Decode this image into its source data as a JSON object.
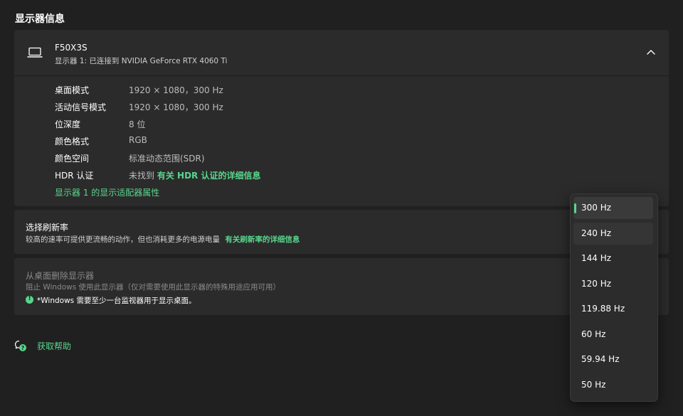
{
  "section_title": "显示器信息",
  "monitor": {
    "name": "F50X3S",
    "subtitle": "显示器 1: 已连接到 NVIDIA GeForce RTX 4060 Ti",
    "details": [
      {
        "label": "桌面模式",
        "value": "1920 × 1080，300 Hz"
      },
      {
        "label": "活动信号模式",
        "value": "1920 × 1080，300 Hz"
      },
      {
        "label": "位深度",
        "value": "8 位"
      },
      {
        "label": "颜色格式",
        "value": "RGB"
      },
      {
        "label": "颜色空间",
        "value": "标准动态范围(SDR)"
      },
      {
        "label": "HDR 认证",
        "value": "未找到",
        "link": "有关 HDR 认证的详细信息"
      }
    ],
    "adapter_link": "显示器 1 的显示适配器属性"
  },
  "refresh": {
    "title": "选择刷新率",
    "description": "较高的速率可提供更流畅的动作，但也消耗更多的电源电量",
    "link": "有关刷新率的详细信息"
  },
  "remove": {
    "title": "从桌面删除显示器",
    "description": "阻止 Windows 使用此显示器（仅对需要使用此显示器的特殊用途应用可用）",
    "note": "*Windows 需要至少一台监视器用于显示桌面。"
  },
  "help": {
    "label": "获取帮助"
  },
  "dropdown": {
    "options": [
      "300 Hz",
      "240 Hz",
      "144 Hz",
      "120 Hz",
      "119.88 Hz",
      "60 Hz",
      "59.94 Hz",
      "50 Hz"
    ],
    "selected_index": 0,
    "hover_index": 1
  },
  "colors": {
    "accent": "#58d68d",
    "background": "#202020",
    "card": "#2b2b2b"
  },
  "icons": {
    "monitor": "laptop-icon",
    "collapse": "chevron-up-icon",
    "help": "help-chat-icon",
    "info": "info-icon"
  }
}
